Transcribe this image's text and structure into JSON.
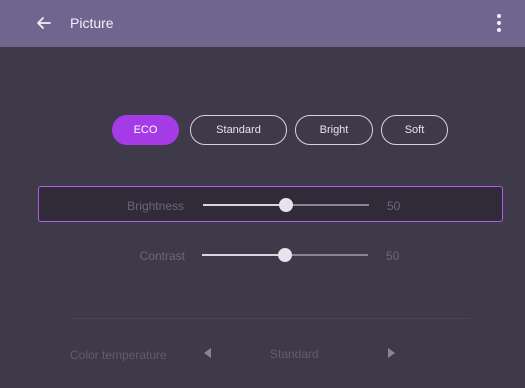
{
  "header": {
    "title": "Picture"
  },
  "modes": [
    {
      "label": "ECO",
      "active": true
    },
    {
      "label": "Standard",
      "active": false
    },
    {
      "label": "Bright",
      "active": false
    },
    {
      "label": "Soft",
      "active": false
    }
  ],
  "sliders": {
    "brightness": {
      "label": "Brightness",
      "value": "50",
      "level": 50
    },
    "contrast": {
      "label": "Contrast",
      "value": "50",
      "level": 50
    }
  },
  "color_temperature": {
    "label": "Color temperature",
    "value": "Standard"
  },
  "colors": {
    "accent": "#a53be6",
    "header_bg": "#6f6690",
    "screen_bg": "#3f3a4a"
  },
  "icons": {
    "back": "arrow-left-icon",
    "menu": "more-vertical-icon",
    "prev": "triangle-left-icon",
    "next": "triangle-right-icon"
  }
}
